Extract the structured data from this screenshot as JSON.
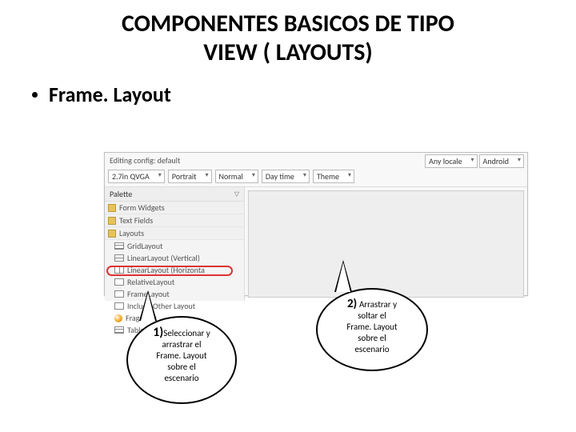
{
  "title_line1": "COMPONENTES  BASICOS DE TIPO",
  "title_line2": "VIEW ( LAYOUTS)",
  "bullet": "Frame. Layout",
  "editor": {
    "editing_label": "Editing config: default",
    "dd_device": "2.7in QVGA",
    "dd_orient": "Portrait",
    "dd_mode": "Normal",
    "dd_day": "Day time",
    "dd_theme": "Theme",
    "dd_locale": "Any locale",
    "dd_platform": "Android",
    "palette_header": "Palette",
    "sections": {
      "form_widgets": "Form Widgets",
      "text_fields": "Text Fields",
      "layouts": "Layouts"
    },
    "layout_items": {
      "grid": "GridLayout",
      "linear_v": "LinearLayout (Vertical)",
      "linear_h": "LinearLayout (Horizonta",
      "relative": "RelativeLayout",
      "frame": "FrameLayout",
      "include": "Include Other Layout",
      "fragment": "Fragment",
      "table": "TableLayout"
    }
  },
  "callout1": {
    "lead": "1)",
    "text1": "Seleccionar y",
    "text2": "arrastrar  el",
    "text3": "Frame. Layout",
    "text4": "sobre el",
    "text5": "escenario"
  },
  "callout2": {
    "lead": "2)",
    "text1": "Arrastrar   y",
    "text2": "soltar   el",
    "text3": "Frame. Layout",
    "text4": "sobre el",
    "text5": "escenario"
  }
}
